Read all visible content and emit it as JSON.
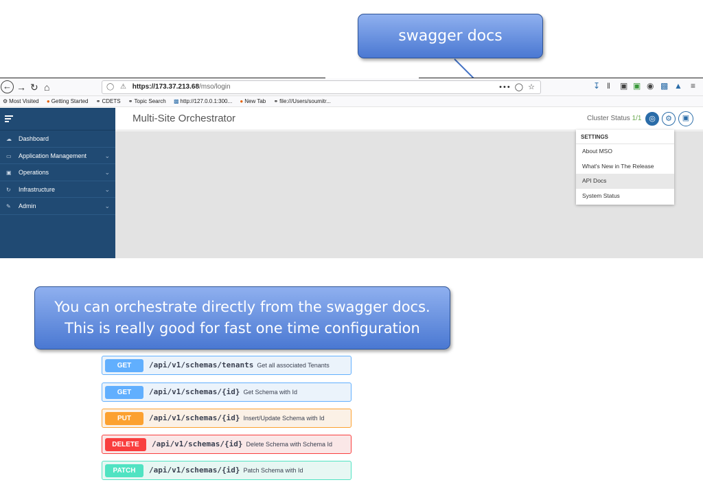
{
  "callouts": {
    "top": "swagger docs",
    "bottom_line1": "You can orchestrate directly from the swagger docs.",
    "bottom_line2": "This is really good for fast one time configuration"
  },
  "browser": {
    "url_host": "https://173.37.213.68",
    "url_path": "/mso/login",
    "url_more": "•••",
    "bookmarks": [
      {
        "icon": "gear-icon",
        "label": "Most Visited"
      },
      {
        "icon": "firefox-icon",
        "label": "Getting Started"
      },
      {
        "icon": "globe-icon",
        "label": "CDETS"
      },
      {
        "icon": "globe-icon",
        "label": "Topic Search"
      },
      {
        "icon": "page-icon",
        "label": "http://127.0.0.1:300..."
      },
      {
        "icon": "firefox-icon",
        "label": "New Tab"
      },
      {
        "icon": "globe-icon",
        "label": "file:///Users/soumitr..."
      }
    ]
  },
  "app": {
    "title": "Multi-Site Orchestrator",
    "cluster_label": "Cluster Status ",
    "cluster_value": "1/1",
    "sidebar": [
      {
        "label": "Dashboard",
        "icon": "cloud-icon",
        "expandable": false
      },
      {
        "label": "Application Management",
        "icon": "app-icon",
        "expandable": true
      },
      {
        "label": "Operations",
        "icon": "operations-icon",
        "expandable": true
      },
      {
        "label": "Infrastructure",
        "icon": "refresh-icon",
        "expandable": true
      },
      {
        "label": "Admin",
        "icon": "admin-icon",
        "expandable": true
      }
    ],
    "settings_menu": {
      "heading": "SETTINGS",
      "items": [
        "About MSO",
        "What's New in The Release",
        "API Docs",
        "System Status"
      ],
      "active_index": 2
    }
  },
  "swagger_ops": [
    {
      "method": "GET",
      "path": "/api/v1/schemas/tenants",
      "desc": "Get all associated Tenants",
      "color": "#61affe"
    },
    {
      "method": "GET",
      "path": "/api/v1/schemas/{id}",
      "desc": "Get Schema with Id",
      "color": "#61affe"
    },
    {
      "method": "PUT",
      "path": "/api/v1/schemas/{id}",
      "desc": "Insert/Update Schema with Id",
      "color": "#fca130"
    },
    {
      "method": "DELETE",
      "path": "/api/v1/schemas/{id}",
      "desc": "Delete Schema with Schema Id",
      "color": "#f93e3e"
    },
    {
      "method": "PATCH",
      "path": "/api/v1/schemas/{id}",
      "desc": "Patch Schema with Id",
      "color": "#50e3c2"
    }
  ]
}
